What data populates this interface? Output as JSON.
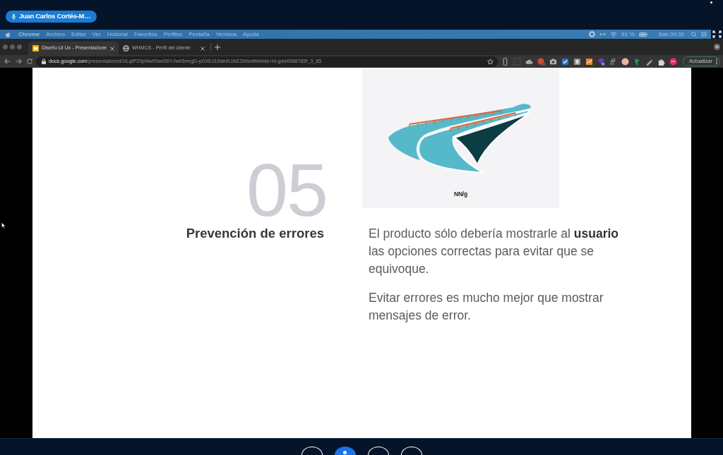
{
  "meeting": {
    "speaker": "Juan Carlos Cortés-M…"
  },
  "menu_bar": {
    "app": "Chrome",
    "items": [
      "Archivo",
      "Editar",
      "Ver",
      "Historial",
      "Favoritos",
      "Perfiles",
      "Pestaña",
      "Ventana",
      "Ayuda"
    ],
    "battery": "91 %",
    "clock": "Sab 09:39"
  },
  "tabs": [
    {
      "title": "Diseño UI Ux - Presentacione",
      "kind": "slides",
      "selected": true
    },
    {
      "title": "WHMCS - Perfil del cliente",
      "kind": "web",
      "selected": false
    }
  ],
  "address_bar": {
    "host": "docs.google.com",
    "path": "/presentation/d/1lLqtPZ9pNwfXtw05IYJwh5mrgD-yDXEz19delXJAE2M/edit#slide=id.gdd4588785f_3_85"
  },
  "update_button": "Actualizar",
  "slide": {
    "number": "05",
    "title": "Prevención de errores",
    "image": {
      "logo": "NN/g"
    },
    "paragraphs": [
      "El producto sólo debería mostrarle al **usuario** las opciones correctas para evitar que se equivoque.",
      "Evitar errores es mucho mejor que mostrar mensajes de error."
    ]
  },
  "call_controls": [
    {
      "on": false
    },
    {
      "on": true
    },
    {
      "on": false
    },
    {
      "on": false
    }
  ]
}
